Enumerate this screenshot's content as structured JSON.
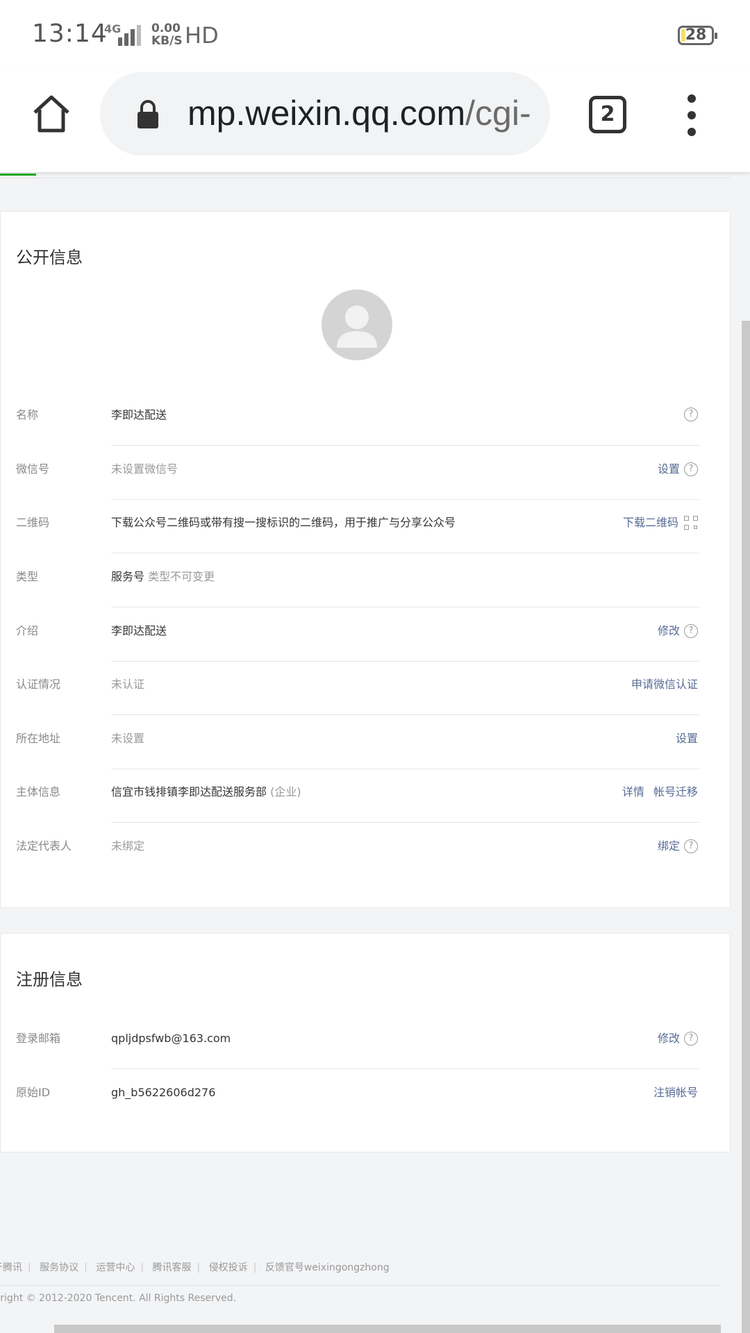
{
  "status_bar": {
    "time": "13:14",
    "network": "4G",
    "speed_value": "0.00",
    "speed_unit": "KB/S",
    "hd": "HD",
    "battery": "28"
  },
  "browser": {
    "url_host": "mp.weixin.qq.com",
    "url_path": "/cgi-",
    "tab_count": "2"
  },
  "public_info": {
    "title": "公开信息",
    "rows": [
      {
        "label": "名称",
        "value": "李即达配送"
      },
      {
        "label": "微信号",
        "value": "未设置微信号",
        "action": "设置"
      },
      {
        "label": "二维码",
        "value": "下载公众号二维码或带有搜一搜标识的二维码，用于推广与分享公众号",
        "action": "下载二维码"
      },
      {
        "label": "类型",
        "value": "服务号",
        "note": "类型不可变更"
      },
      {
        "label": "介绍",
        "value": "李即达配送",
        "action": "修改"
      },
      {
        "label": "认证情况",
        "value": "未认证",
        "action": "申请微信认证"
      },
      {
        "label": "所在地址",
        "value": "未设置",
        "action": "设置"
      },
      {
        "label": "主体信息",
        "value": "信宜市钱排镇李即达配送服务部",
        "note": "(企业)",
        "action": "详情",
        "action2": "帐号迁移"
      },
      {
        "label": "法定代表人",
        "value": "未绑定",
        "action": "绑定"
      }
    ]
  },
  "register_info": {
    "title": "注册信息",
    "rows": [
      {
        "label": "登录邮箱",
        "value": "qpljdpsfwb@163.com",
        "action": "修改"
      },
      {
        "label": "原始ID",
        "value": "gh_b5622606d276",
        "action": "注销帐号"
      }
    ]
  },
  "footer": {
    "links": [
      "于腾讯",
      "服务协议",
      "运营中心",
      "腾讯客服",
      "侵权投诉",
      "反馈官号weixingongzhong"
    ],
    "copyright": "yright © 2012-2020 Tencent. All Rights Reserved."
  },
  "colors": {
    "link": "#576b95",
    "accent": "#1aad19",
    "page_bg": "#f3f4f6"
  }
}
